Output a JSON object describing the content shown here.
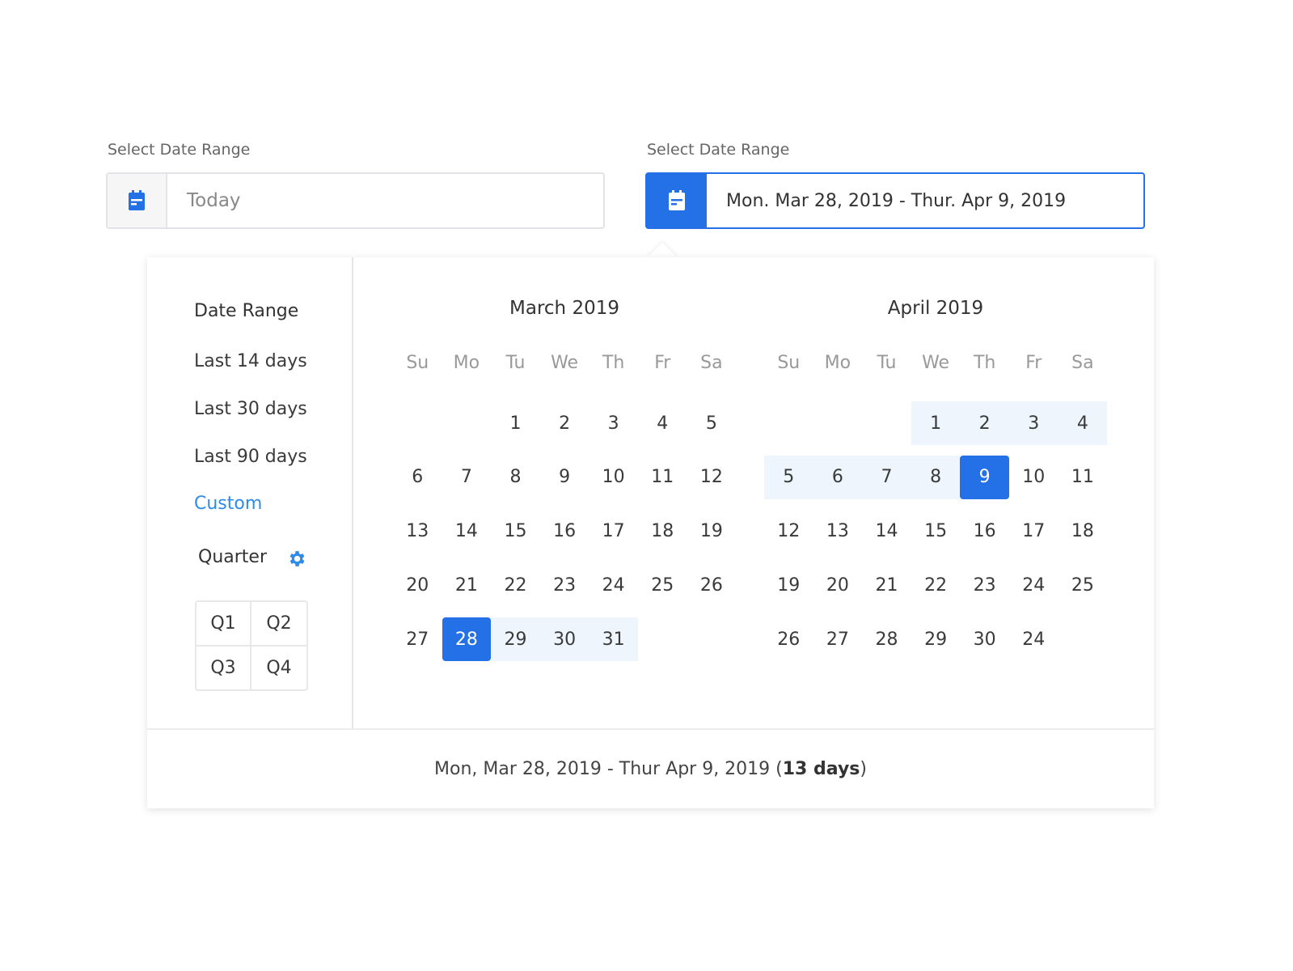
{
  "fields": [
    {
      "label": "Select Date Range",
      "value": "Today",
      "icon": "calendar-icon"
    },
    {
      "label": "Select Date Range",
      "value": "Mon. Mar 28, 2019 - Thur. Apr 9, 2019",
      "icon": "calendar-icon"
    }
  ],
  "sidebar": {
    "title": "Date Range",
    "presets": [
      "Last 14 days",
      "Last 30 days",
      "Last 90 days",
      "Custom"
    ],
    "active_preset": "Custom",
    "quarter_label": "Quarter",
    "quarter_icon": "gear-icon",
    "quarters": [
      "Q1",
      "Q2",
      "Q3",
      "Q4"
    ]
  },
  "weekdays": [
    "Su",
    "Mo",
    "Tu",
    "We",
    "Th",
    "Fr",
    "Sa"
  ],
  "months": [
    {
      "title": "March 2019",
      "weeks": [
        [
          null,
          null,
          1,
          2,
          3,
          4,
          5
        ],
        [
          6,
          7,
          8,
          9,
          10,
          11,
          12
        ],
        [
          13,
          14,
          15,
          16,
          17,
          18,
          19
        ],
        [
          20,
          21,
          22,
          23,
          24,
          25,
          26
        ],
        [
          27,
          28,
          29,
          30,
          31,
          null,
          null
        ]
      ],
      "selected": [
        28
      ],
      "in_range": [
        29,
        30,
        31
      ]
    },
    {
      "title": "April 2019",
      "weeks": [
        [
          null,
          null,
          null,
          1,
          2,
          3,
          4
        ],
        [
          5,
          6,
          7,
          8,
          9,
          10,
          11
        ],
        [
          12,
          13,
          14,
          15,
          16,
          17,
          18
        ],
        [
          19,
          20,
          21,
          22,
          23,
          24,
          25
        ],
        [
          26,
          27,
          28,
          29,
          30,
          24,
          null
        ]
      ],
      "selected": [
        9
      ],
      "in_range": [
        1,
        2,
        3,
        4,
        5,
        6,
        7,
        8
      ]
    }
  ],
  "footer": {
    "range_text": "Mon, Mar 28, 2019 - Thur Apr 9, 2019 (",
    "days": "13 days",
    ")": ")",
    "close": ")"
  },
  "colors": {
    "accent": "#2470e6",
    "range_bg": "#eef5fd",
    "link": "#2f8be8"
  }
}
